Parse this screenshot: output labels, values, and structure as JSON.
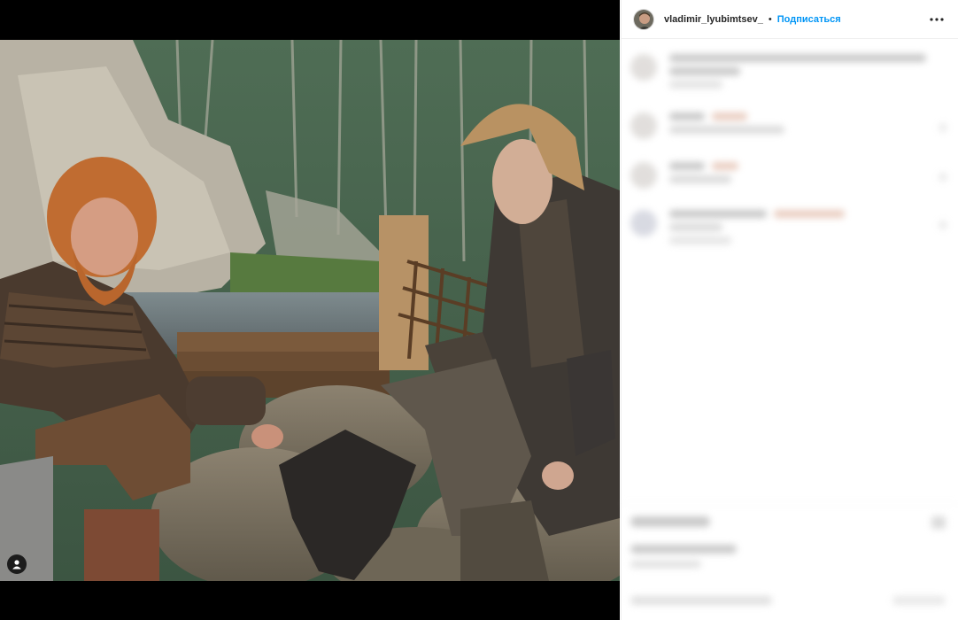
{
  "post": {
    "username": "vladimir_lyubimtsev_",
    "separator": "•",
    "follow_label": "Подписаться"
  },
  "icons": {
    "more": "more-options-icon",
    "tagged_users": "person-tag-icon"
  },
  "colors": {
    "follow_link": "#0095f6",
    "media_background": "#000000",
    "panel_background": "#ffffff"
  }
}
